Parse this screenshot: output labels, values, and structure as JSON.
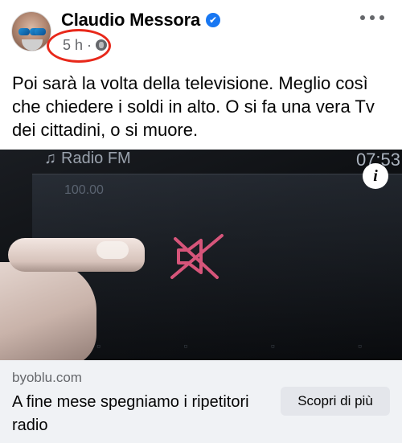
{
  "post": {
    "author": "Claudio Messora",
    "verified_badge": "✔",
    "time": "5 h",
    "separator": "·",
    "privacy_icon": "globe-icon",
    "more_icon": "more-horizontal-icon",
    "text": "Poi sarà la volta della televisione. Meglio così che chiedere i soldi in alto. O si fa una vera Tv dei cittadini, o si muore."
  },
  "media": {
    "radio_label": "Radio FM",
    "note_glyph": "♫",
    "frequency": "100.00",
    "clock": "07:53",
    "info_label": "i",
    "mute_icon": "muted-speaker-icon"
  },
  "link": {
    "domain": "byoblu.com",
    "title": "A fine mese spegniamo i ripetitori radio",
    "cta_label": "Scopri di più"
  },
  "colors": {
    "accent": "#1877f2",
    "highlight": "#e8281a",
    "mute_icon": "#d6557a",
    "secondary_text": "#65676b",
    "link_bar_bg": "#f0f2f5"
  }
}
